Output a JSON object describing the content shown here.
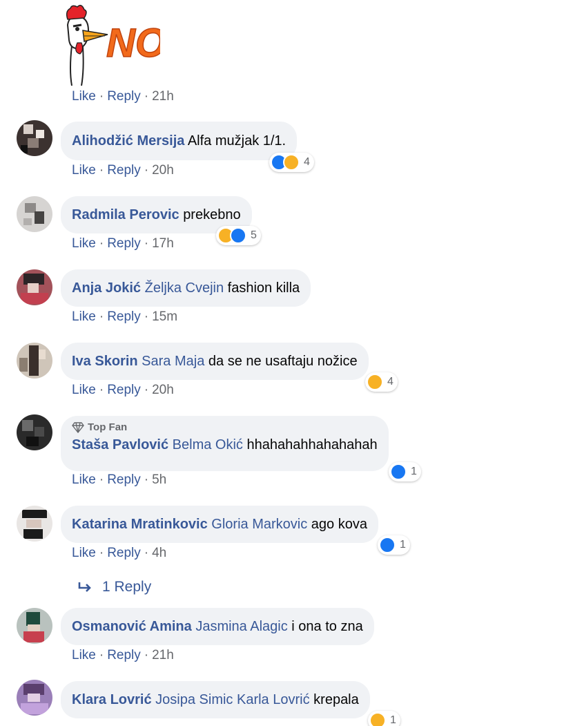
{
  "actions": {
    "like": "Like",
    "reply": "Reply"
  },
  "first": {
    "time": "21h"
  },
  "comments": [
    {
      "author": "Alihodžić Mersija",
      "mention": "",
      "text": "Alfa mužjak 1/1.",
      "time": "20h",
      "reactions": [
        "like",
        "haha"
      ],
      "count": "4",
      "topfan": ""
    },
    {
      "author": "Radmila Perovic",
      "mention": "",
      "text": "prekebno",
      "time": "17h",
      "reactions": [
        "haha",
        "like"
      ],
      "count": "5",
      "topfan": ""
    },
    {
      "author": "Anja Jokić",
      "mention": "Željka Cvejin",
      "text": "fashion killa",
      "time": "15m",
      "reactions": [],
      "count": "",
      "topfan": ""
    },
    {
      "author": "Iva Skorin",
      "mention": "Sara Maja",
      "text": "da se ne usaftaju nožice",
      "time": "20h",
      "reactions": [
        "haha"
      ],
      "count": "4",
      "topfan": ""
    },
    {
      "author": "Staša Pavlović",
      "mention": "Belma Okić",
      "text": "hhahahahhahahahah",
      "time": "5h",
      "reactions": [
        "like"
      ],
      "count": "1",
      "topfan": "Top Fan"
    },
    {
      "author": "Katarina Mratinkovic",
      "mention": "Gloria Markovic",
      "text": "ago kova",
      "time": "4h",
      "reactions": [
        "like"
      ],
      "count": "1",
      "topfan": ""
    },
    {
      "author": "Osmanović Amina",
      "mention": "Jasmina Alagic",
      "text": "i ona to zna",
      "time": "21h",
      "reactions": [],
      "count": "",
      "topfan": ""
    },
    {
      "author": "Klara Lovrić",
      "mention": "Josipa Simic Karla Lovrić",
      "text": "krepala",
      "time": "",
      "reactions": [
        "haha"
      ],
      "count": "1",
      "topfan": ""
    }
  ],
  "reply_link": {
    "label": "1 Reply"
  },
  "sticker": {
    "text": "NO"
  },
  "colors": {
    "link": "#385898",
    "meta": "#65676b",
    "bubble": "#f0f2f5",
    "like": "#1877f2",
    "haha": "#f7b125"
  }
}
